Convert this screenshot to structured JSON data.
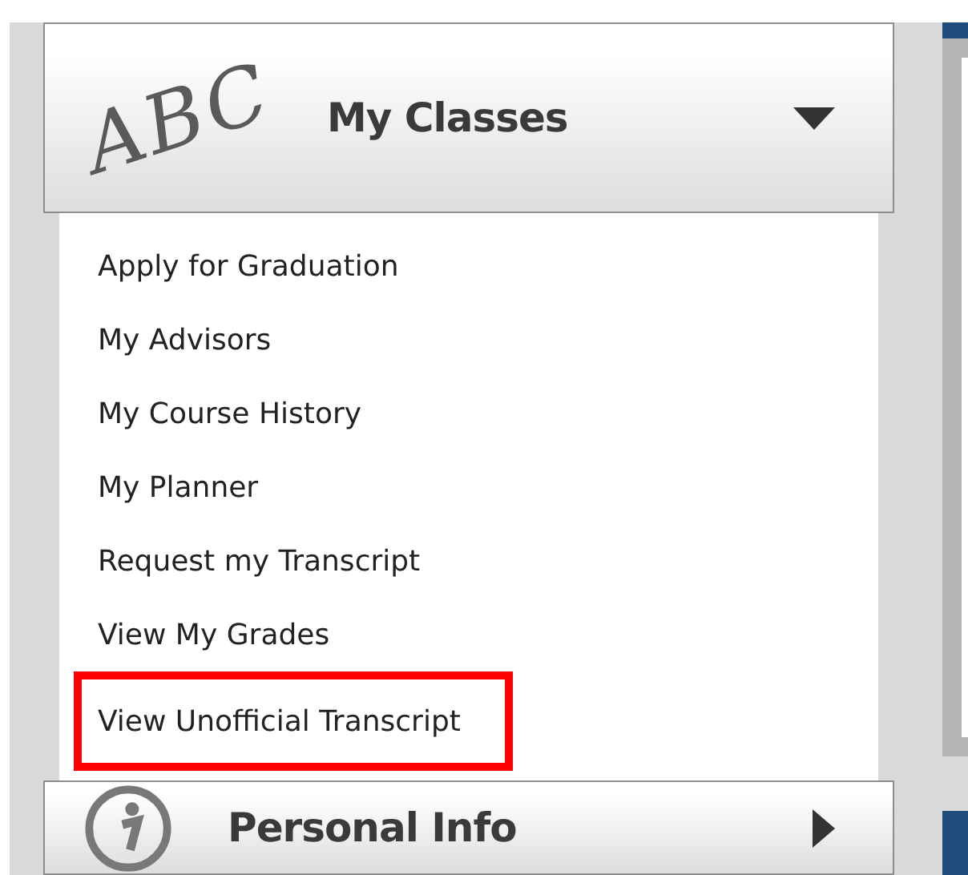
{
  "menus": [
    {
      "kind": "letters",
      "logo_text": "ABC",
      "title": "My Classes",
      "expanded": true,
      "items": [
        {
          "label": "Apply for Graduation",
          "highlighted": false
        },
        {
          "label": "My Advisors",
          "highlighted": false
        },
        {
          "label": "My Course History",
          "highlighted": false
        },
        {
          "label": "My Planner",
          "highlighted": false
        },
        {
          "label": "Request my Transcript",
          "highlighted": false
        },
        {
          "label": "View My Grades",
          "highlighted": false
        },
        {
          "label": "View Unofficial Transcript",
          "highlighted": true
        }
      ]
    },
    {
      "kind": "info",
      "title": "Personal Info",
      "expanded": false
    }
  ]
}
